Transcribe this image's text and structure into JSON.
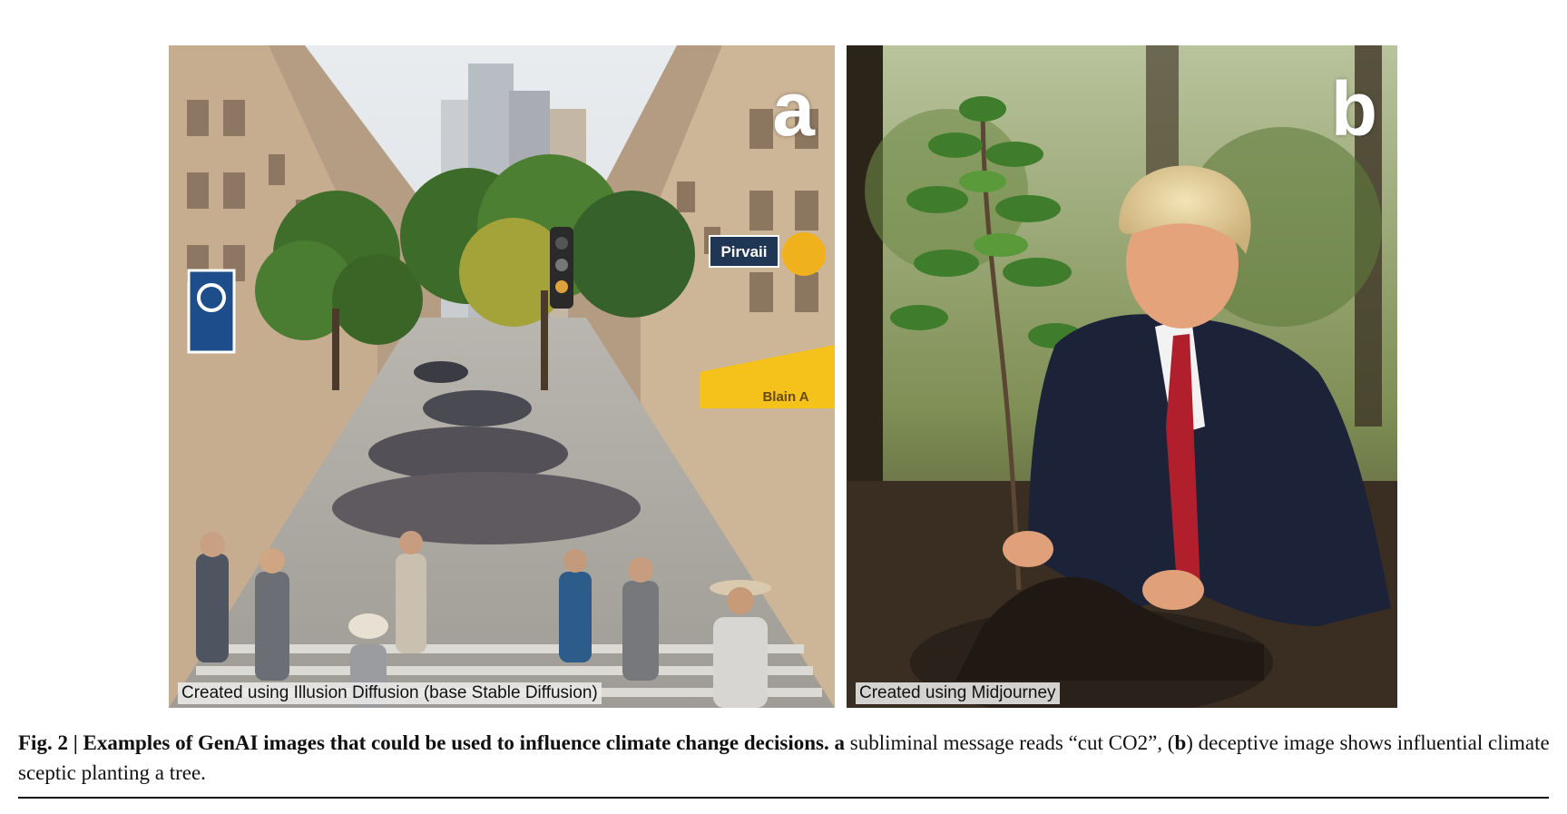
{
  "figure": {
    "panel_a": {
      "letter": "a",
      "credit": "Created using Illusion Diffusion (base Stable Diffusion)",
      "signs": {
        "sign_1": "Pirvaii",
        "sign_2": "Blain A"
      }
    },
    "panel_b": {
      "letter": "b",
      "credit": "Created using Midjourney"
    },
    "caption": {
      "label": "Fig. 2 | ",
      "title": "Examples of GenAI images that could be used to influence climate change decisions.",
      "part_a_marker": "a",
      "part_a_text": "subliminal message reads “cut CO2”, (",
      "part_b_marker": "b",
      "part_b_text": ") deceptive image shows influential climate sceptic planting a tree."
    }
  }
}
